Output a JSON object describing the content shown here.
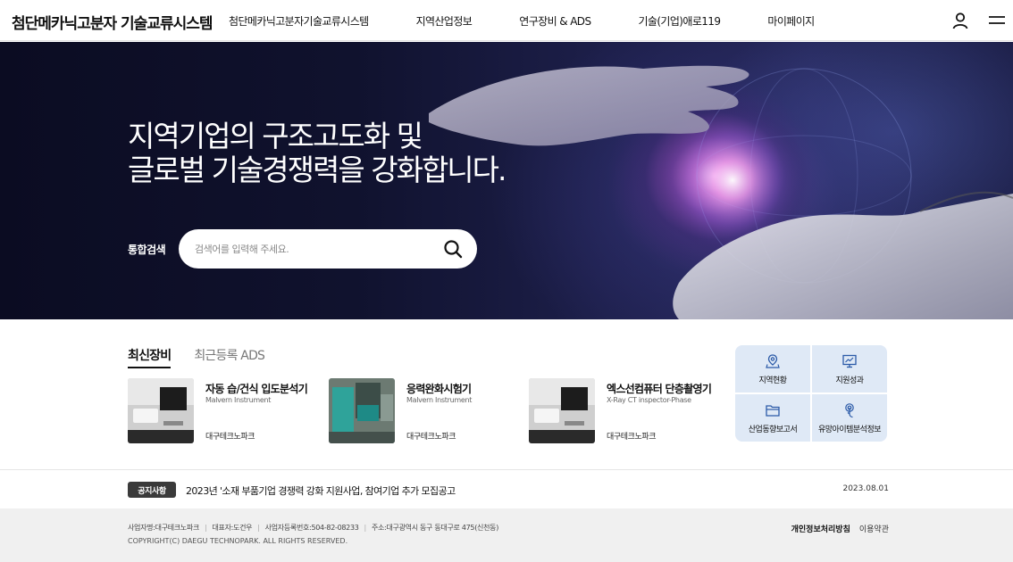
{
  "header": {
    "logo": "첨단메카닉고분자 기술교류시스템",
    "nav": [
      "첨단메카닉고분자기술교류시스템",
      "지역산업정보",
      "연구장비 & ADS",
      "기술(기업)애로119",
      "마이페이지"
    ]
  },
  "hero": {
    "title_line1": "지역기업의 구조고도화 및",
    "title_line2": "글로벌 기술경쟁력을 강화합니다.",
    "search_label": "통합검색",
    "search_placeholder": "검색어를 입력해 주세요."
  },
  "tabs": [
    "최신장비",
    "최근등록 ADS"
  ],
  "equipment": [
    {
      "name": "자동 습/건식 입도분석기",
      "maker": "Malvern Instrument",
      "org": "대구테크노파크"
    },
    {
      "name": "응력완화시험기",
      "maker": "Malvern Instrument",
      "org": "대구테크노파크"
    },
    {
      "name": "엑스선컴퓨터 단층촬영기",
      "maker": "X-Ray CT inspector-Phase",
      "org": "대구테크노파크"
    }
  ],
  "quick_links": [
    "지역현황",
    "지원성과",
    "산업동향보고서",
    "유망아이템분석정보"
  ],
  "notice": {
    "badge": "공지사항",
    "text": "2023년 '소재 부품기업 경쟁력 강화 지원사업, 참여기업 추가 모집공고",
    "date": "2023.08.01"
  },
  "footer": {
    "company": "사업자명:대구테크노파크",
    "ceo": "대표자:도건우",
    "reg_no": "사업자등록번호:504-82-08233",
    "address": "주소:대구광역시 동구 동대구로 475(신천동)",
    "copyright": "COPYRIGHT(C) DAEGU TECHNOPARK. ALL RIGHTS RESERVED.",
    "privacy": "개인정보처리방침",
    "terms": "이용약관"
  },
  "colors": {
    "hero_bg": "#10122e",
    "quick_bg": "#dfe9f6",
    "badge_bg": "#3a3a3a",
    "footer_bg": "#f0f0f0"
  }
}
